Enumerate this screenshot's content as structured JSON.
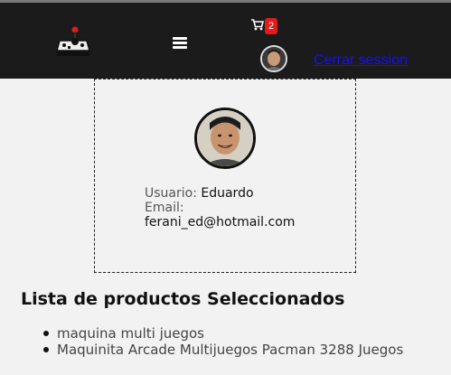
{
  "navbar": {
    "logo_icon": "arcade-joystick-icon",
    "menu_icon": "hamburger-menu-icon",
    "cart_icon": "shopping-cart-icon",
    "cart_count": "2",
    "logout_label": "Cerrar session",
    "colors": {
      "background": "#1b1b1b",
      "badge": "#e21b1b",
      "link": "#1a0dff"
    }
  },
  "profile": {
    "username_label": "Usuario:",
    "username": "Eduardo",
    "email_label": "Email:",
    "email": "ferani_ed@hotmail.com"
  },
  "products": {
    "title": "Lista de productos Seleccionados",
    "items": [
      "maquina multi juegos",
      "Maquinita Arcade Multijuegos Pacman 3288 Juegos"
    ]
  }
}
